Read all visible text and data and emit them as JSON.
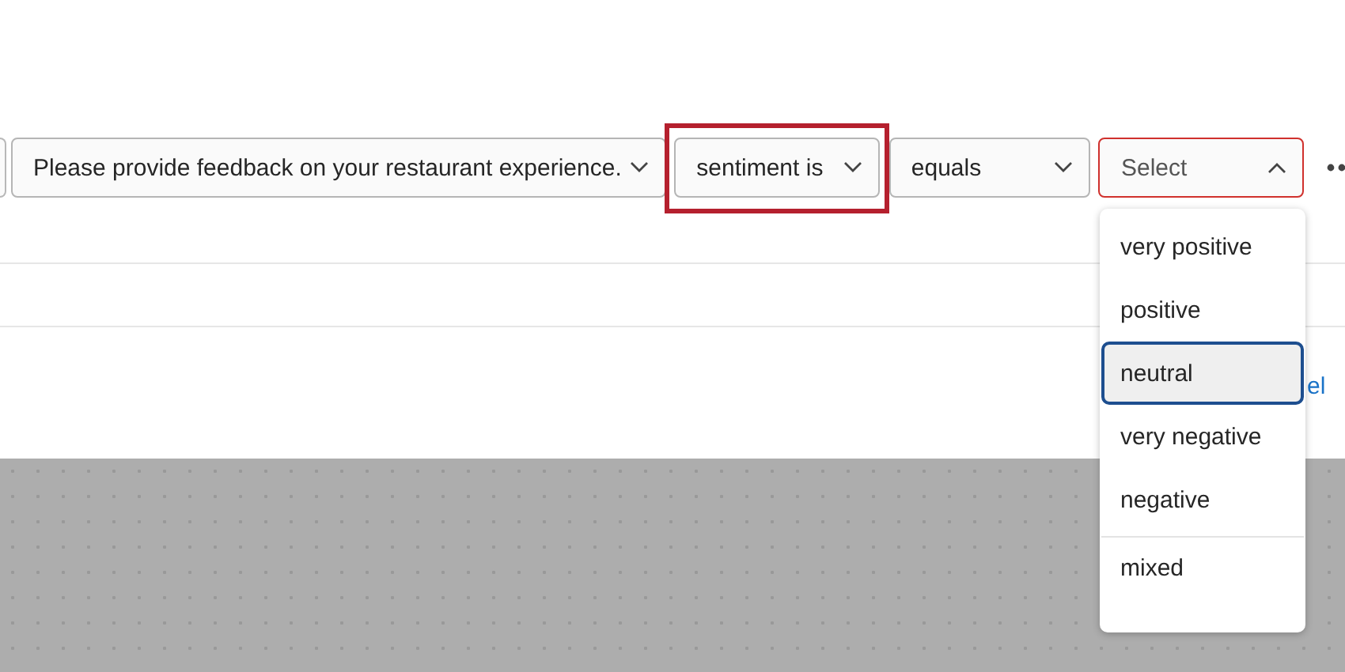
{
  "condition_row": {
    "question_select": {
      "value": "Please provide feedback on your restaurant experience."
    },
    "field_select": {
      "value": "sentiment is",
      "highlighted": true
    },
    "operator_select": {
      "value": "equals"
    },
    "value_select": {
      "placeholder": "Select",
      "open": true,
      "error": true
    }
  },
  "value_options": [
    {
      "label": "very positive",
      "selected": false,
      "separated_above": false
    },
    {
      "label": "positive",
      "selected": false,
      "separated_above": false
    },
    {
      "label": "neutral",
      "selected": true,
      "separated_above": false
    },
    {
      "label": "very negative",
      "selected": false,
      "separated_above": false
    },
    {
      "label": "negative",
      "selected": false,
      "separated_above": false
    },
    {
      "label": "mixed",
      "selected": false,
      "separated_above": true
    }
  ],
  "partial_link": {
    "text": "el"
  }
}
